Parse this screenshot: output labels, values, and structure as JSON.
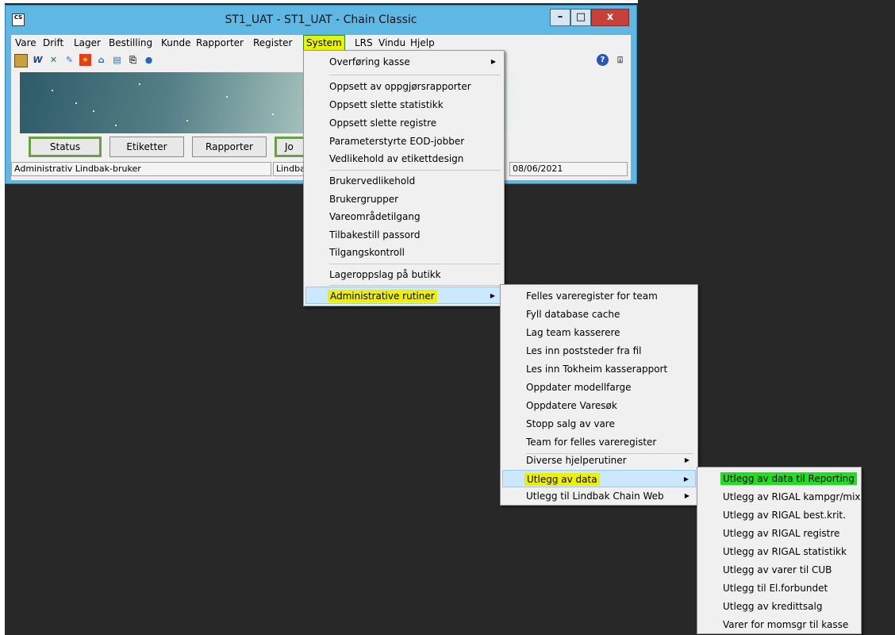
{
  "window": {
    "title": "ST1_UAT  -  ST1_UAT  -  Chain Classic",
    "icon_text": "CS"
  },
  "menubar": [
    "Vare",
    "Drift",
    "Lager",
    "Bestilling",
    "Kunde",
    "Rapporter",
    "Register",
    "System",
    "LRS",
    "Vindu",
    "Hjelp"
  ],
  "toolbar_icons": [
    "calculator-icon",
    "word-icon",
    "excel-icon",
    "edit-icon",
    "shield-icon",
    "home-icon",
    "document-icon",
    "print-preview-icon",
    "globe-icon",
    "help-icon",
    "exit-door-icon"
  ],
  "buttons": {
    "status": "Status",
    "etiketter": "Etiketter",
    "rapporter": "Rapporter",
    "jo": "Jo"
  },
  "statusbar": {
    "user": "Administrativ Lindbak-bruker",
    "lindbak": "Lindbak",
    "date": "08/06/2021"
  },
  "system_menu": {
    "overforing": "Overføring kasse",
    "oppgjor": "Oppsett av oppgjørsrapporter",
    "slette_statistikk": "Oppsett slette statistikk",
    "slette_registre": "Oppsett slette registre",
    "eod": "Parameterstyrte EOD-jobber",
    "etikett": "Vedlikehold av etikettdesign",
    "brukervedlikehold": "Brukervedlikehold",
    "brukergrupper": "Brukergrupper",
    "vareomrade": "Vareområdetilgang",
    "passord": "Tilbakestill passord",
    "tilgang": "Tilgangskontroll",
    "lageroppslag": "Lageroppslag på butikk",
    "admin": "Administrative rutiner"
  },
  "admin_menu": {
    "felles": "Felles vareregister for team",
    "fyll": "Fyll database cache",
    "lag_team": "Lag team kasserere",
    "poststeder": "Les inn poststeder fra fil",
    "tokheim": "Les inn Tokheim kasserapport",
    "modellfarge": "Oppdater modellfarge",
    "varesok": "Oppdatere Varesøk",
    "stopp": "Stopp salg av vare",
    "team_felles": "Team for felles vareregister",
    "diverse": "Diverse hjelperutiner",
    "utlegg_data": "Utlegg av data",
    "utlegg_web": "Utlegg til Lindbak Chain Web"
  },
  "export_menu": {
    "reporting": "Utlegg av data til Reporting",
    "kampgr": "Utlegg av RIGAL kampgr/mix",
    "bestkrit": "Utlegg av RIGAL best.krit.",
    "registre": "Utlegg av RIGAL registre",
    "statistikk": "Utlegg av RIGAL statistikk",
    "cub": "Utlegg av varer til CUB",
    "elforbundet": "Utlegg til El.forbundet",
    "kredittsalg": "Utlegg av kredittsalg",
    "momsgr": "Varer for momsgr til kasse"
  },
  "colors": {
    "highlight_yellow": "#eef000",
    "highlight_green": "#1ee01e",
    "title_bar": "#5fb8e3",
    "desktop": "#282828"
  }
}
